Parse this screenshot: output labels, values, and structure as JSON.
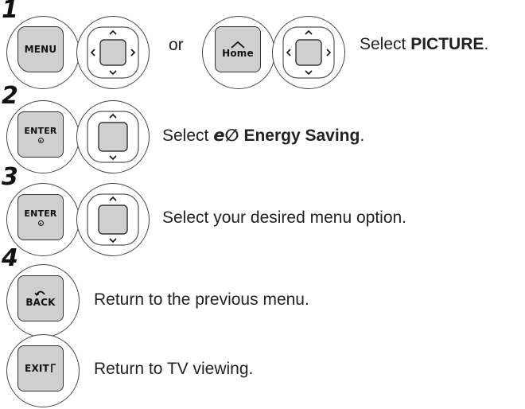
{
  "steps": [
    {
      "number": "1",
      "keys": [
        "MENU",
        "Home"
      ],
      "or_label": "or",
      "instruction_prefix": "Select ",
      "instruction_bold": "PICTURE",
      "instruction_suffix": "."
    },
    {
      "number": "2",
      "keys": [
        "ENTER"
      ],
      "instruction_prefix": "Select ",
      "instruction_symbol": "e∅",
      "instruction_bold": "Energy Saving",
      "instruction_suffix": "."
    },
    {
      "number": "3",
      "keys": [
        "ENTER"
      ],
      "instruction": "Select your desired menu option."
    },
    {
      "number": "4",
      "keys": [
        "BACK"
      ],
      "instruction": "Return to the previous menu."
    },
    {
      "keys": [
        "EXIT"
      ],
      "instruction": "Return to TV viewing."
    }
  ],
  "icons": {
    "nav_pad_4way": "four-way-navigation-pad-icon",
    "nav_pad_updown": "up-down-navigation-pad-icon",
    "home": "home-icon",
    "back_arrow": "back-arrow-icon",
    "exit_box": "exit-box-icon"
  },
  "colors": {
    "key_fill": "#cfcfcf",
    "ring": "#444444",
    "text": "#222222"
  }
}
